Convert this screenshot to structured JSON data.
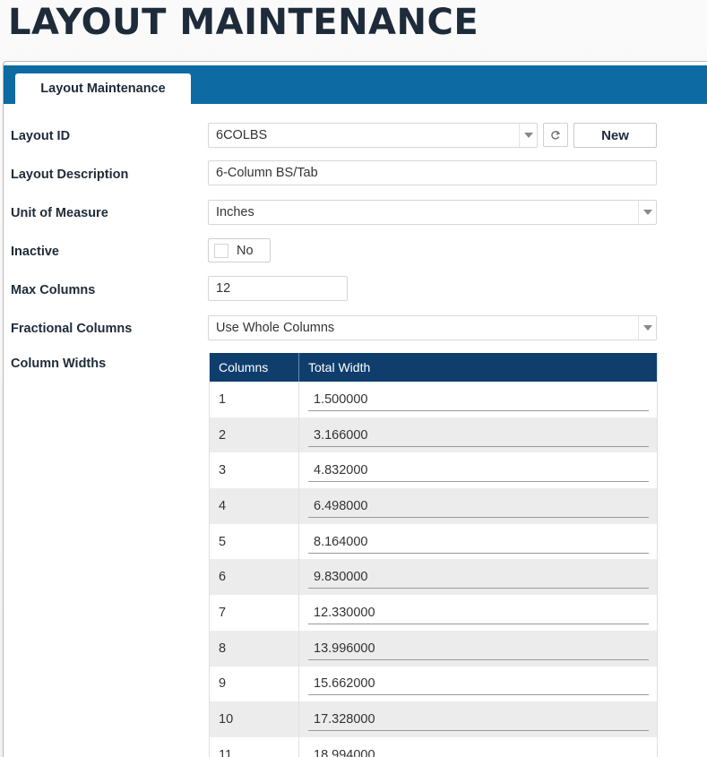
{
  "page": {
    "title": "LAYOUT MAINTENANCE"
  },
  "tabs": [
    {
      "label": "Layout Maintenance"
    }
  ],
  "form": {
    "layout_id": {
      "label": "Layout ID",
      "value": "6COLBS"
    },
    "new_button": "New",
    "layout_description": {
      "label": "Layout Description",
      "value": "6-Column BS/Tab"
    },
    "unit_of_measure": {
      "label": "Unit of Measure",
      "value": "Inches"
    },
    "inactive": {
      "label": "Inactive",
      "value_text": "No",
      "checked": false
    },
    "max_columns": {
      "label": "Max Columns",
      "value": "12"
    },
    "fractional_columns": {
      "label": "Fractional Columns",
      "value": "Use Whole Columns"
    },
    "column_widths": {
      "label": "Column Widths"
    }
  },
  "grid": {
    "headers": [
      "Columns",
      "Total Width"
    ],
    "rows": [
      {
        "col": "1",
        "width": "1.500000"
      },
      {
        "col": "2",
        "width": "3.166000"
      },
      {
        "col": "3",
        "width": "4.832000"
      },
      {
        "col": "4",
        "width": "6.498000"
      },
      {
        "col": "5",
        "width": "8.164000"
      },
      {
        "col": "6",
        "width": "9.830000"
      },
      {
        "col": "7",
        "width": "12.330000"
      },
      {
        "col": "8",
        "width": "13.996000"
      },
      {
        "col": "9",
        "width": "15.662000"
      },
      {
        "col": "10",
        "width": "17.328000"
      },
      {
        "col": "11",
        "width": "18.994000"
      }
    ]
  },
  "colors": {
    "tab_bar": "#0e6aa2",
    "grid_header": "#0f3e6d",
    "title": "#1d2b3a"
  },
  "icons": {
    "dropdown": "chevron-down-icon",
    "refresh": "refresh-icon"
  }
}
